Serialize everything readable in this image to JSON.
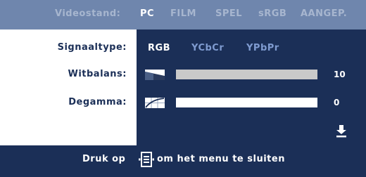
{
  "topbar": {
    "label": "Videostand:",
    "options": [
      "PC",
      "FILM",
      "SPEL",
      "sRGB",
      "AANGEP."
    ],
    "active_index": 0
  },
  "rows": {
    "signal_label": "Signaaltype:",
    "signal_options": [
      "RGB",
      "YCbCr",
      "YPbPr"
    ],
    "signal_active_index": 0,
    "whitebalance_label": "Witbalans:",
    "whitebalance_value": "10",
    "whitebalance_level": 1.0,
    "degamma_label": "Degamma:",
    "degamma_value": "0",
    "degamma_level": 0.0
  },
  "icons": {
    "whitebalance": "whitebalance-icon",
    "degamma": "degamma-curve-icon",
    "scroll": "scroll-down-arrow-icon",
    "menu": "menu-button-icon"
  },
  "footer": {
    "text_before": "Druk op",
    "text_after": "om het menu te sluiten"
  },
  "colors": {
    "background": "#1b2f57",
    "topbar": "#6f86ad",
    "inactive_tab": "#a7b6cf",
    "inactive_signal": "#7f9bd0",
    "bar_track": "#c9c9c9"
  }
}
